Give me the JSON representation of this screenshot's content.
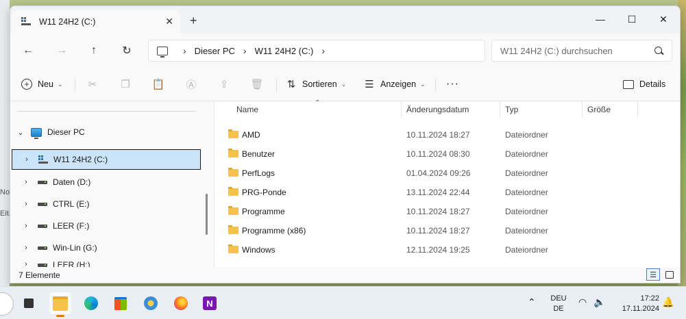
{
  "desktop": {
    "left_edge_texts": [
      "Nov",
      "Eita"
    ]
  },
  "tab": {
    "title": "W11 24H2 (C:)",
    "close_label": "✕",
    "new_tab_label": "+"
  },
  "window_controls": {
    "minimize": "—",
    "maximize": "☐",
    "close": "✕"
  },
  "nav_buttons": {
    "back": "←",
    "forward": "→",
    "up": "↑",
    "refresh": "↻"
  },
  "address": {
    "crumbs": [
      "Dieser PC",
      "W11 24H2 (C:)"
    ],
    "separator": "›"
  },
  "search": {
    "placeholder": "W11 24H2 (C:) durchsuchen"
  },
  "toolbar": {
    "new_label": "Neu",
    "sort_label": "Sortieren",
    "view_label": "Anzeigen",
    "more_label": "···",
    "details_label": "Details"
  },
  "nav_pane": {
    "root": {
      "label": "Dieser PC",
      "expanded": true
    },
    "items": [
      {
        "label": "W11 24H2 (C:)",
        "selected": true
      },
      {
        "label": "Daten (D:)"
      },
      {
        "label": "CTRL (E:)"
      },
      {
        "label": "LEER (F:)"
      },
      {
        "label": "Win-Lin (G:)"
      },
      {
        "label": "LEER (H:)"
      }
    ]
  },
  "file_list": {
    "columns": [
      "Name",
      "Änderungsdatum",
      "Typ",
      "Größe"
    ],
    "rows": [
      {
        "name": "AMD",
        "date": "10.11.2024 18:27",
        "type": "Dateiordner"
      },
      {
        "name": "Benutzer",
        "date": "10.11.2024 08:30",
        "type": "Dateiordner"
      },
      {
        "name": "PerfLogs",
        "date": "01.04.2024 09:26",
        "type": "Dateiordner"
      },
      {
        "name": "PRG-Ponde",
        "date": "13.11.2024 22:44",
        "type": "Dateiordner"
      },
      {
        "name": "Programme",
        "date": "10.11.2024 18:27",
        "type": "Dateiordner"
      },
      {
        "name": "Programme (x86)",
        "date": "10.11.2024 18:27",
        "type": "Dateiordner"
      },
      {
        "name": "Windows",
        "date": "12.11.2024 19:25",
        "type": "Dateiordner"
      }
    ]
  },
  "status": {
    "count": "7 Elemente"
  },
  "taskbar": {
    "apps": [
      "explorer-icon",
      "edge-icon",
      "store-icon",
      "settings-icon",
      "firefox-icon",
      "onenote-icon"
    ],
    "lang_top": "DEU",
    "lang_bottom": "DE",
    "time": "17:22",
    "date": "17.11.2024"
  },
  "colors": {
    "selection": "#cce4f7",
    "folder": "#f4c24d",
    "accent": "#0067c0"
  }
}
